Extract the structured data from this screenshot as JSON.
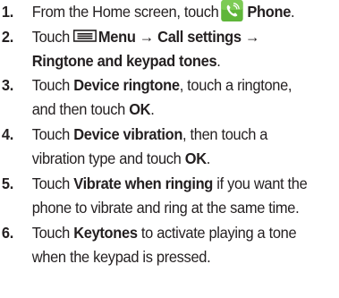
{
  "steps": [
    {
      "number": "1.",
      "line1_prefix": "From the Home screen, touch",
      "icon": "phone-app-icon",
      "line1_bold": "Phone",
      "line1_end": "."
    },
    {
      "number": "2.",
      "prefix": "Touch",
      "icon": "menu-icon",
      "bold_line1": "Menu → Call settings →",
      "bold_line2": "Ringtone and keypad tones",
      "end": "."
    },
    {
      "number": "3.",
      "prefix": "Touch",
      "bold1": "Device ringtone",
      "mid": ", touch a ringtone,",
      "line2": "and then touch",
      "bold2": "OK",
      "end": "."
    },
    {
      "number": "4.",
      "prefix": "Touch",
      "bold1": "Device vibration",
      "mid": ", then touch a",
      "line2": "vibration type and touch",
      "bold2": "OK",
      "end": "."
    },
    {
      "number": "5.",
      "prefix": "Touch",
      "bold1": "Vibrate when ringing",
      "mid": " if you want the",
      "line2": "phone to vibrate and ring at the same time."
    },
    {
      "number": "6.",
      "prefix": "Touch",
      "bold1": "Keytones",
      "mid": " to activate playing a tone",
      "line2": "when the keypad is pressed."
    }
  ],
  "colors": {
    "text": "#231f20",
    "phone_icon_bg": "#5fb63a",
    "phone_icon_glyph": "#ffffff",
    "menu_icon": "#231f20"
  }
}
